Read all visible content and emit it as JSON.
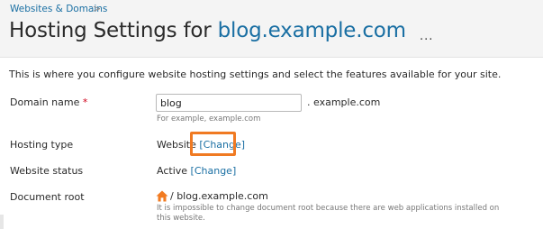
{
  "breadcrumb": {
    "item": "Websites & Domains",
    "separator": ">"
  },
  "header": {
    "title_prefix": "Hosting Settings for",
    "title_domain": "blog.example.com",
    "more_label": "..."
  },
  "intro_text": "This is where you configure website hosting settings and select the features available for your site.",
  "form": {
    "domain_name": {
      "label": "Domain name",
      "required_mark": "*",
      "value": "blog",
      "suffix": ". example.com",
      "hint": "For example, example.com"
    },
    "hosting_type": {
      "label": "Hosting type",
      "value": "Website",
      "change_label": "[Change]"
    },
    "website_status": {
      "label": "Website status",
      "value": "Active",
      "change_label": "[Change]"
    },
    "document_root": {
      "label": "Document root",
      "icon": "home-icon",
      "value": "/ blog.example.com",
      "note_line1": "It is impossible to change document root because there are web applications installed on",
      "note_line2": "this website."
    }
  },
  "colors": {
    "link": "#1a6fa3",
    "highlight": "#f07a22",
    "required": "#d0021b"
  }
}
